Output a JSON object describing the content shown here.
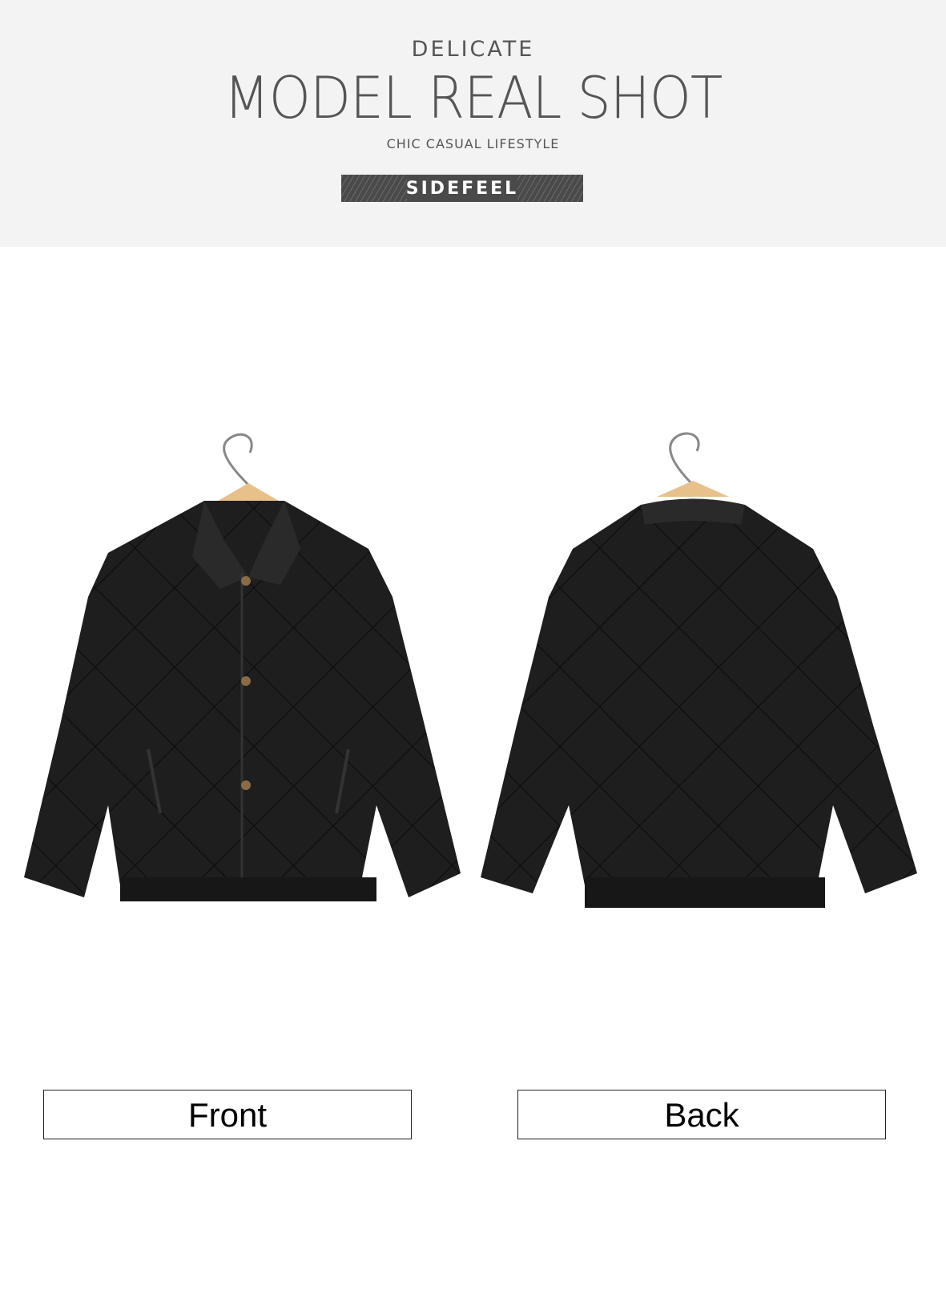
{
  "header": {
    "kicker": "DELICATE",
    "title": "MODEL REAL SHOT",
    "tagline": "CHIC CASUAL LIFESTYLE",
    "brand": "SIDEFEEL"
  },
  "views": [
    {
      "label": "Front"
    },
    {
      "label": "Back"
    }
  ],
  "colors": {
    "header_bg": "#f3f3f3",
    "text": "#555555",
    "brand_bar": "#4a4a4a",
    "jacket": "#1c1c1c"
  }
}
